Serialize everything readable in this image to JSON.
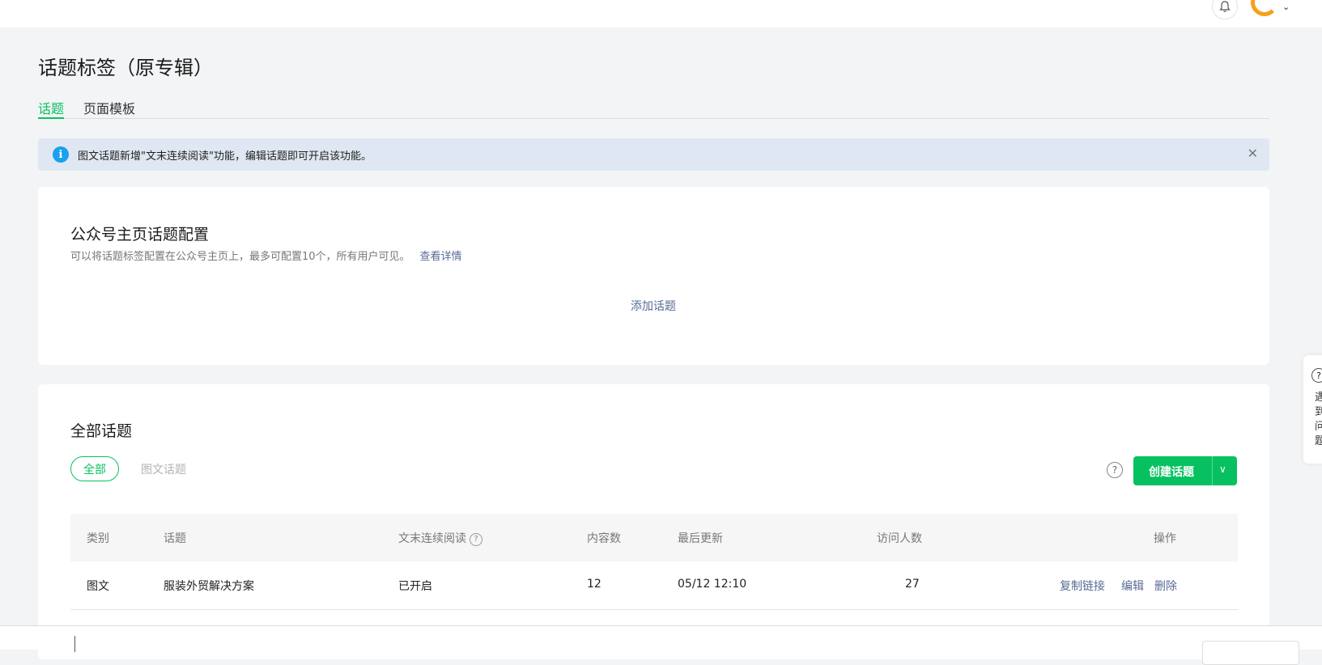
{
  "header": {
    "bell_icon": "bell-icon",
    "avatar_caret": "⌄"
  },
  "page": {
    "title": "话题标签（原专辑）"
  },
  "tabs": [
    {
      "label": "话题",
      "active": true
    },
    {
      "label": "页面模板",
      "active": false
    }
  ],
  "notice": {
    "icon": "i",
    "text": "图文话题新增\"文末连续阅读\"功能，编辑话题即可开启该功能。",
    "close": "✕"
  },
  "homepage_config": {
    "title": "公众号主页话题配置",
    "desc": "可以将话题标签配置在公众号主页上，最多可配置10个，所有用户可见。",
    "link": "查看详情",
    "add_label": "添加话题"
  },
  "all_topics": {
    "title": "全部话题",
    "filters": [
      "全部",
      "图文话题"
    ],
    "help": "?",
    "create_label": "创建话题",
    "create_caret": "∨",
    "table": {
      "headers": [
        "类别",
        "话题",
        "文末连续阅读",
        "内容数",
        "最后更新",
        "访问人数",
        "操作"
      ],
      "rows": [
        {
          "category": "图文",
          "topic": "服装外贸解决方案",
          "continuous": "已开启",
          "count": "12",
          "updated": "05/12 12:10",
          "visitors": "27",
          "ops": [
            "复制链接",
            "编辑",
            "删除"
          ]
        }
      ]
    }
  },
  "side_help": {
    "q": "?",
    "text": "遇到问题"
  },
  "colors": {
    "accent": "#07c160",
    "link": "#576b95",
    "notice_bg": "#dfe8f2",
    "info": "#1aa0f0"
  }
}
